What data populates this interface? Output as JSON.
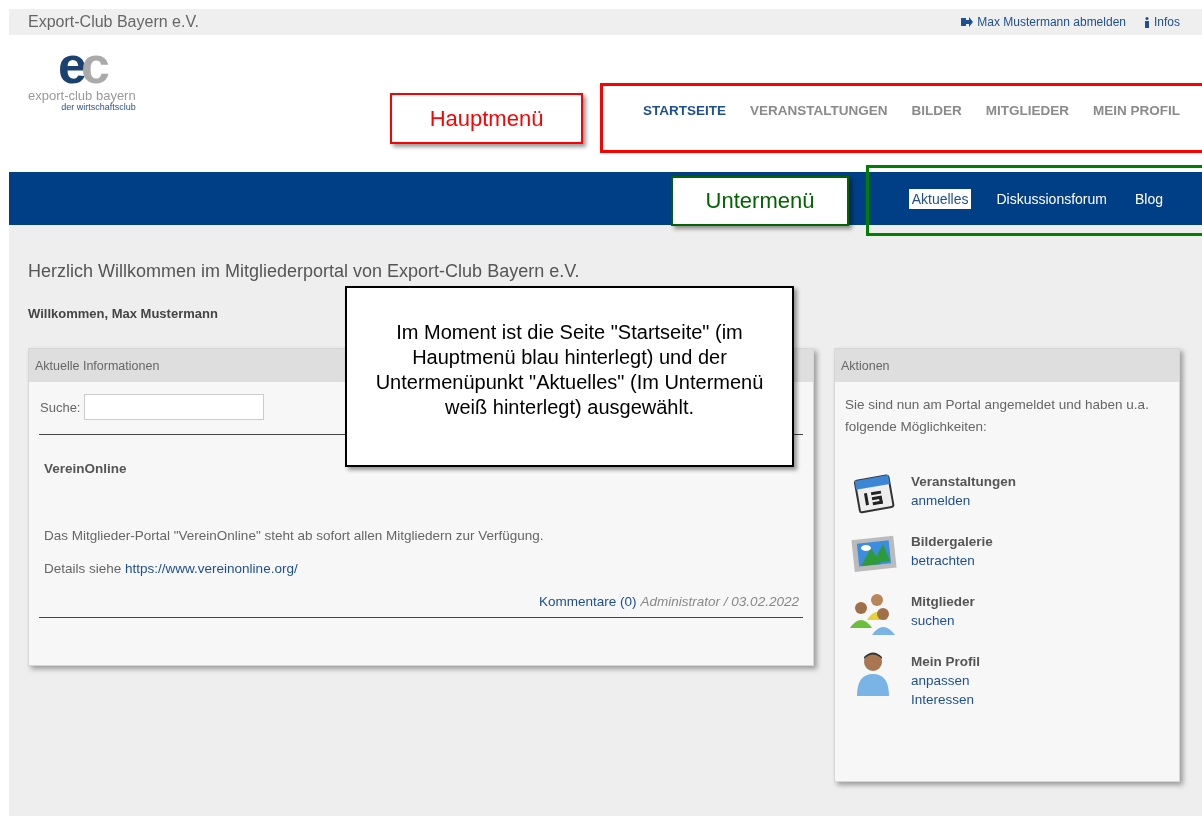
{
  "top_bar": {
    "site_title": "Export-Club Bayern e.V.",
    "links": [
      {
        "kind": "logout",
        "label": "Max Mustermann abmelden"
      },
      {
        "kind": "info",
        "label": "Infos"
      }
    ]
  },
  "logo": {
    "letters": [
      "e",
      "c"
    ],
    "name": "export-club bayern",
    "tagline": "der wirtschaftsclub"
  },
  "main_menu": [
    {
      "label": "STARTSEITE",
      "selected": true
    },
    {
      "label": "VERANSTALTUNGEN",
      "selected": false
    },
    {
      "label": "BILDER",
      "selected": false
    },
    {
      "label": "MITGLIEDER",
      "selected": false
    },
    {
      "label": "MEIN PROFIL",
      "selected": false
    }
  ],
  "sub_menu": [
    {
      "label": "Aktuelles",
      "selected": true
    },
    {
      "label": "Diskussionsforum",
      "selected": false
    },
    {
      "label": "Blog",
      "selected": false
    }
  ],
  "page_title": "Herzlich Willkommen im Mitgliederportal von Export-Club Bayern e.V.",
  "welcome": "Willkommen, Max Mustermann",
  "news_card": {
    "title": "Aktuelle Informationen",
    "search_label": "Suche:",
    "article": {
      "title": "VereinOnline",
      "body": "Das Mitglieder-Portal \"VereinOnline\" steht ab sofort allen Mitgliedern zur Verfügung.",
      "details_prefix": "Details siehe",
      "link": "https://www.vereinonline.org/",
      "comments": "Kommentare (0)",
      "meta": "Administrator / 03.02.2022"
    }
  },
  "actions_card": {
    "title": "Aktionen",
    "intro": "Sie sind nun am Portal angemeldet und haben u.a. folgende Möglichkeiten:",
    "actions": [
      {
        "kind": "calendar",
        "title": "Veranstaltungen",
        "links": [
          "anmelden"
        ]
      },
      {
        "kind": "gallery",
        "title": "Bildergalerie",
        "links": [
          "betrachten"
        ]
      },
      {
        "kind": "members",
        "title": "Mitglieder",
        "links": [
          "suchen"
        ]
      },
      {
        "kind": "profile",
        "title": "Mein Profil",
        "links": [
          "anpassen",
          "Interessen"
        ]
      }
    ]
  },
  "annotations": [
    {
      "kind": "frame",
      "color": "#ff0000"
    },
    {
      "kind": "label",
      "color": "#ff0000",
      "text": "Hauptmenü"
    },
    {
      "kind": "frame",
      "color": "#008000"
    },
    {
      "kind": "label",
      "color": "#006400",
      "text": "Untermenü"
    },
    {
      "kind": "note",
      "color": "#000000",
      "text": "Im Moment ist die Seite \"Startseite\" (im Hauptmenü blau hinterlegt) und der Untermenüpunkt \"Aktuelles\" (Im Untermenü weiß hinterlegt) ausgewählt."
    }
  ]
}
